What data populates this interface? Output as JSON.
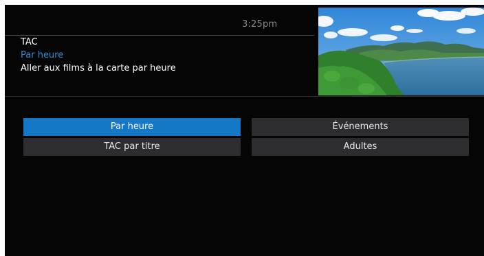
{
  "header": {
    "time": "3:25pm",
    "title": "TAC",
    "subtitle": "Par heure",
    "description": "Aller aux films à la carte par heure"
  },
  "menu": {
    "items": [
      {
        "label": "Par heure",
        "selected": true
      },
      {
        "label": "Événements",
        "selected": false
      },
      {
        "label": "TAC par titre",
        "selected": false
      },
      {
        "label": "Adultes",
        "selected": false
      }
    ]
  },
  "colors": {
    "background": "#050506",
    "accent": "#1578c6",
    "subtitle_text": "#2f8ed6",
    "button": "#2d2d30"
  }
}
